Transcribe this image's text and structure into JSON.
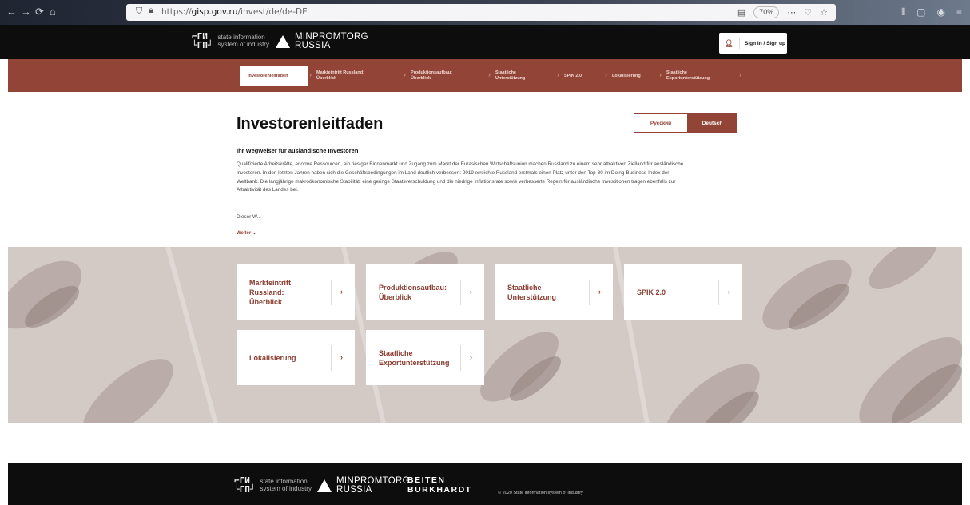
{
  "browser": {
    "url_prefix": "https://",
    "url_host": "gisp.gov.ru",
    "url_path": "/invest/de/de-DE",
    "zoom": "70%"
  },
  "header": {
    "sis_logo_text": "state information\nsystem of industry",
    "minpromtorg_text": "MINPROMTORG\nRUSSIA",
    "signin_label": "Sign in / Sign up"
  },
  "nav": {
    "tabs": [
      {
        "label": "Investorenleitfaden"
      },
      {
        "label": "Markteintritt Russland:\nÜberblick"
      },
      {
        "label": "Produktionsaufbau:\nÜberblick"
      },
      {
        "label": "Staatliche\nUnterstützung"
      },
      {
        "label": "SPIK 2.0"
      },
      {
        "label": "Lokalisierung"
      },
      {
        "label": "Staatliche\nExportunterstützung"
      }
    ]
  },
  "main": {
    "title": "Investorenleitfaden",
    "lang_ru": "Русский",
    "lang_de": "Deutsch",
    "subtitle": "Ihr Wegweiser für ausländische Investoren",
    "paragraph": "Qualifizierte Arbeitskräfte, enorme Ressourcen, ein riesiger Binnenmarkt und Zugang zum Markt der Eurasischen Wirtschaftsunion machen Russland zu einem sehr attraktiven Zielland für ausländische Investoren. In den letzten Jahren haben sich die Geschäftsbedingungen im Land deutlich verbessert: 2019 erreichte Russland erstmals einen Platz unter den Top-30 im Doing-Business-Index der Weltbank. Die langjährige makroökonomische Stabilität, eine geringe Staatsverschuldung und die niedrige Inflationsrate sowie verbesserte Regeln für ausländische Investitionen tragen ebenfalls zur Attraktivität des Landes bei.",
    "teaser": "Dieser W...",
    "more_label": "Weiter"
  },
  "cards": [
    {
      "label": "Markteintritt\nRussland:\nÜberblick"
    },
    {
      "label": "Produktionsaufbau:\nÜberblick"
    },
    {
      "label": "Staatliche\nUnterstützung"
    },
    {
      "label": "SPIK 2.0"
    },
    {
      "label": "Lokalisierung"
    },
    {
      "label": "Staatliche\nExportunterstützung"
    }
  ],
  "footer": {
    "sis_logo_text": "state information\nsystem of industry",
    "minpromtorg_text": "MINPROMTORG\nRUSSIA",
    "partner_text": "BEITEN\nBURKHARDT",
    "copyright": "© 2020 State information system of industry"
  },
  "colors": {
    "brand_red": "#924437",
    "black": "#0d0d0d"
  }
}
